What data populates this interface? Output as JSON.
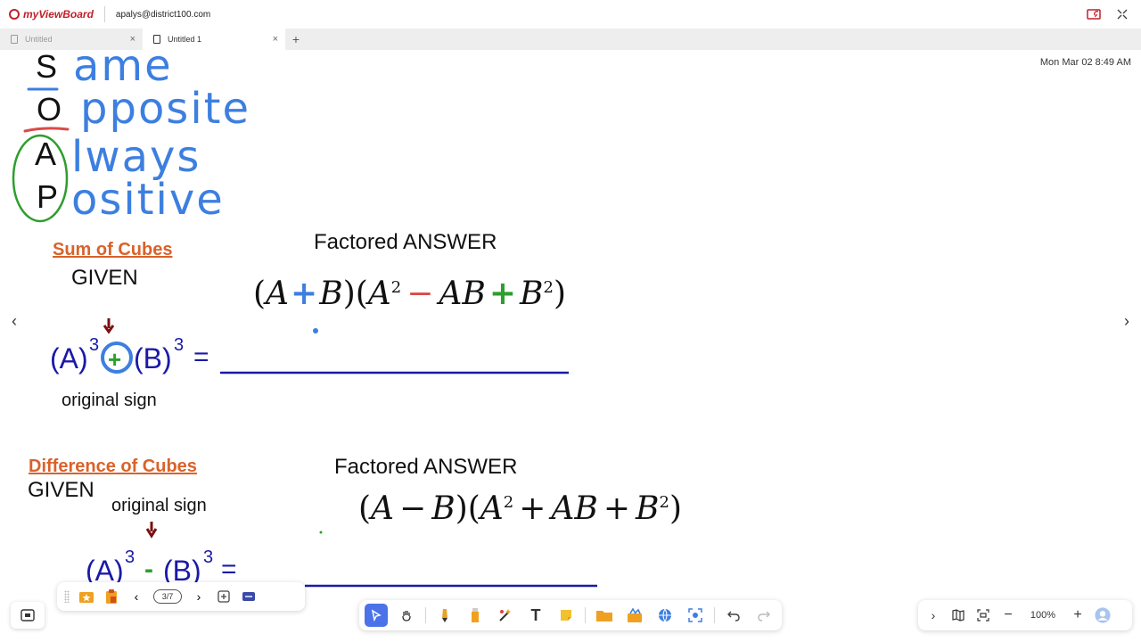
{
  "topbar": {
    "logo_text": "myViewBoard",
    "email": "apalys@district100.com"
  },
  "tabs": [
    {
      "label": "Untitled",
      "active": false
    },
    {
      "label": "Untitled 1",
      "active": true
    }
  ],
  "datetime": "Mon Mar 02 8:49 AM",
  "soap": {
    "letters": [
      "S",
      "O",
      "A",
      "P"
    ],
    "words": [
      "ame",
      "pposite",
      "lways",
      "ositive"
    ]
  },
  "sum": {
    "title": "Sum of Cubes",
    "given": "GIVEN",
    "factored_label": "Factored ANSWER",
    "lhs_a": "(A)",
    "lhs_b": "(B)",
    "exp": "3",
    "sign": "+",
    "equals": "=",
    "original_sign": "original sign",
    "formula": {
      "a": "A",
      "op1": "+",
      "b": "B",
      "a2": "A",
      "sq": "2",
      "op2": "−",
      "ab": "AB",
      "op3": "+",
      "b2": "B"
    }
  },
  "diff": {
    "title": "Difference of Cubes",
    "given": "GIVEN",
    "factored_label": "Factored ANSWER",
    "original_sign": "original sign",
    "lhs_a": "(A)",
    "lhs_b": "(B)",
    "exp": "3",
    "sign": "-",
    "equals": "=",
    "formula": {
      "a": "A",
      "op1": "−",
      "b": "B",
      "a2": "A",
      "sq": "2",
      "op2": "+",
      "ab": "AB",
      "op3": "+",
      "b2": "B"
    }
  },
  "pagebar": {
    "page": "3/7"
  },
  "zoom": {
    "value": "100%"
  },
  "colors": {
    "pen_blue": "#3d7fe0",
    "pen_red": "#d94b48",
    "pen_green": "#2e9e2e",
    "selected_tool": "#4b72e8"
  }
}
